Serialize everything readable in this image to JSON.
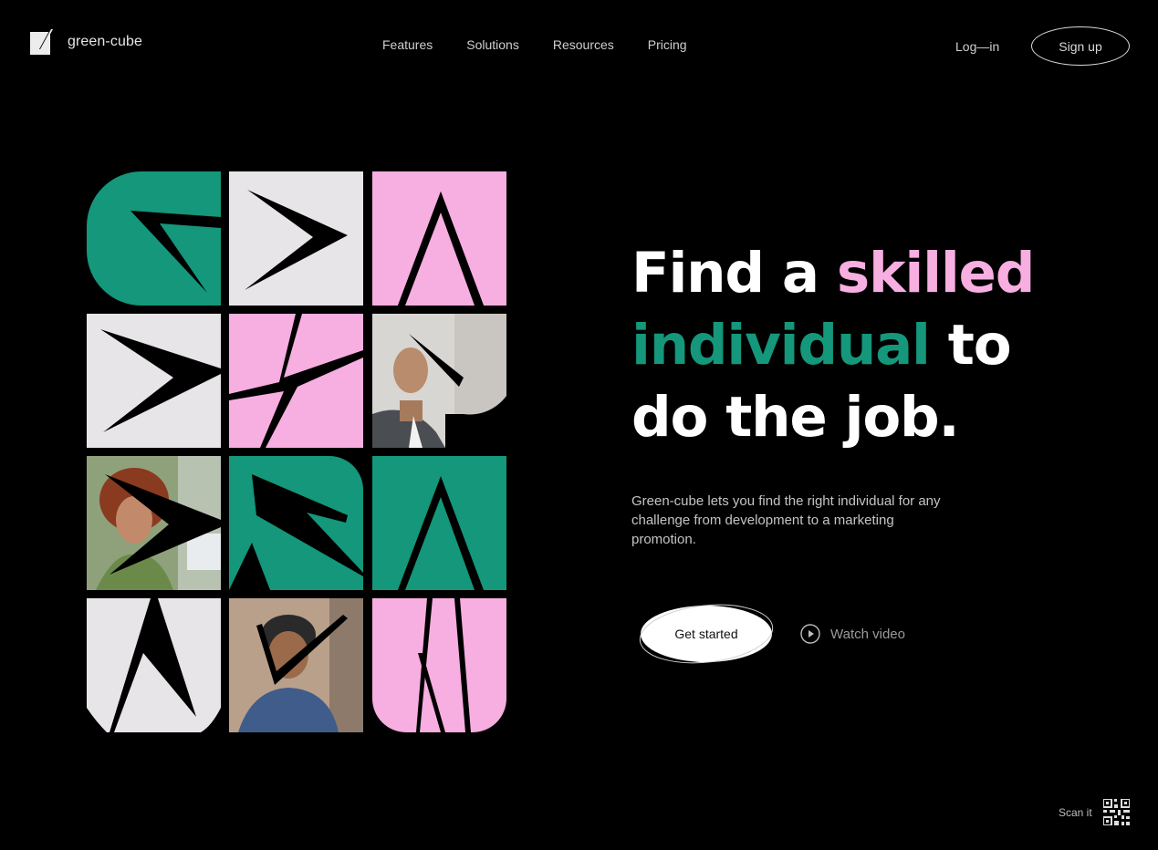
{
  "brand": {
    "name": "green-cube",
    "logo_icon": "slash-cube-logo-icon"
  },
  "nav": {
    "items": [
      {
        "label": "Features"
      },
      {
        "label": "Solutions"
      },
      {
        "label": "Resources"
      },
      {
        "label": "Pricing"
      }
    ]
  },
  "auth": {
    "login_label": "Log—in",
    "signup_label": "Sign up"
  },
  "hero": {
    "headline": {
      "line1_plain": "Find a ",
      "line1_accent": "skilled",
      "line2_accent": "individual",
      "line2_plain": " to",
      "line3_plain": "do the job."
    },
    "description": "Green-cube lets you find the right individual for any challenge from development to a marketing promotion.",
    "cta_primary": "Get started",
    "cta_secondary": "Watch video",
    "cta_secondary_icon": "play-circle-icon"
  },
  "tiles": [
    {
      "kind": "letter",
      "name": "letter-g-tile",
      "color": "green"
    },
    {
      "kind": "letter",
      "name": "arrow-right-tile",
      "color": "light"
    },
    {
      "kind": "letter",
      "name": "letter-a-tile",
      "color": "pink"
    },
    {
      "kind": "letter",
      "name": "arrow-right-tile",
      "color": "light"
    },
    {
      "kind": "letter",
      "name": "letter-x-tile",
      "color": "pink"
    },
    {
      "kind": "photo",
      "name": "person-photo-tile",
      "subject": "man in grey blazer"
    },
    {
      "kind": "photo",
      "name": "person-photo-tile",
      "subject": "woman with curly red hair"
    },
    {
      "kind": "letter",
      "name": "letter-r-tile",
      "color": "green"
    },
    {
      "kind": "letter",
      "name": "letter-a-tile",
      "color": "green"
    },
    {
      "kind": "letter",
      "name": "letter-n-tile",
      "color": "light"
    },
    {
      "kind": "photo",
      "name": "person-photo-tile",
      "subject": "man in beanie and denim jacket"
    },
    {
      "kind": "letter",
      "name": "letter-w-tile",
      "color": "pink"
    }
  ],
  "footer": {
    "scan_label": "Scan it",
    "qr_icon": "qr-code-icon"
  },
  "colors": {
    "background": "#000000",
    "accent_pink": "#f7aee0",
    "accent_green": "#14977a",
    "tile_light": "#e8e5e8"
  }
}
